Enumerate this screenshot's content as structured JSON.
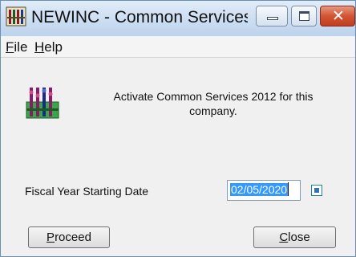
{
  "window": {
    "title": "NEWINC - Common Services ..."
  },
  "menu": {
    "file": {
      "accel": "F",
      "rest": "ile"
    },
    "help": {
      "accel": "H",
      "rest": "elp"
    }
  },
  "content": {
    "message_line1": "Activate Common Services 2012  for this",
    "message_line2": "company.",
    "field_label": "Fiscal Year Starting Date",
    "date_value": "02/05/2020"
  },
  "buttons": {
    "proceed": {
      "accel": "P",
      "rest": "roceed"
    },
    "close": {
      "accel": "C",
      "rest": "lose"
    }
  },
  "icons": {
    "app": "abacus-icon",
    "calendar": "calendar-icon"
  }
}
